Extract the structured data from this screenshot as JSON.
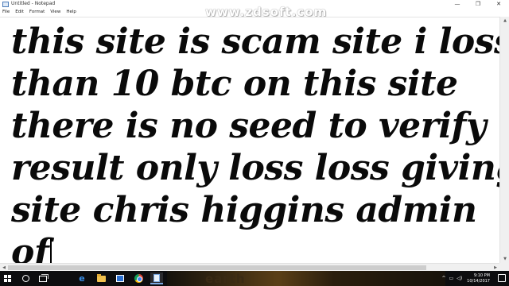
{
  "window": {
    "title": "Untitled - Notepad",
    "controls": {
      "minimize": "—",
      "maximize": "❐",
      "close": "✕"
    }
  },
  "menu": [
    "File",
    "Edit",
    "Format",
    "View",
    "Help"
  ],
  "watermark": "www.zdsoft.com",
  "editor": {
    "lines": [
      "this site is scam site i loss more",
      "than 10 btc on this site",
      "there is no seed to verify",
      "result only loss loss giving",
      "site chris higgins admin",
      "of"
    ]
  },
  "taskbar": {
    "icons": [
      "windows-start-icon",
      "search-icon",
      "task-view-icon",
      "edge-icon",
      "file-explorer-icon",
      "store-icon",
      "chrome-icon",
      "notepad-icon"
    ],
    "edge_glyph": "e",
    "background_text": "earth",
    "tray": {
      "chevron": "^",
      "network": "▭",
      "volume": "◁)",
      "time": "9:10 PM",
      "date": "10/14/2017"
    }
  },
  "colors": {
    "text": "#0a0a0a",
    "taskbar": "#0d0d0f",
    "scrollbar": "#f0f0f0"
  }
}
